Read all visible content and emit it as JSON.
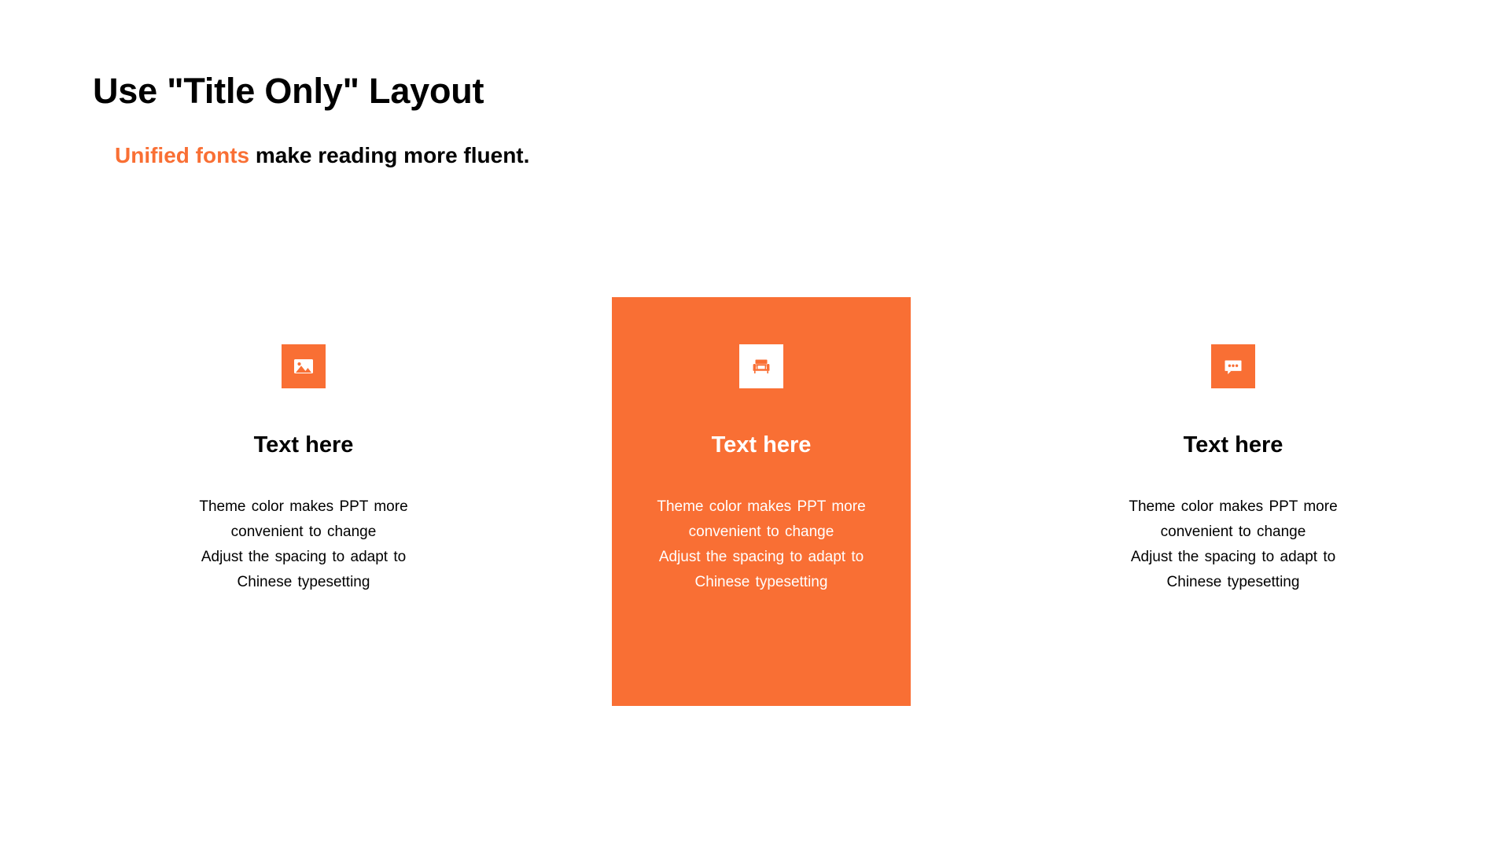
{
  "slide": {
    "background_color": "#FFFFFF",
    "accent_color": "#F96F34",
    "title": "Use \"Title Only\" Layout",
    "subtitle": {
      "accent_text": "Unified fonts",
      "rest_text": " make reading more fluent."
    }
  },
  "columns": [
    {
      "id": "left",
      "icon": "picture-icon",
      "icon_tile_style": "orange-tile-white-glyph",
      "heading": "Text here",
      "body_lines": [
        "Theme  color makes PPT more",
        "convenient to change",
        "Adjust the spacing to adapt to",
        "Chinese typesetting"
      ],
      "text_color": "#000000",
      "panel_color": "#FFFFFF",
      "highlighted": false
    },
    {
      "id": "center",
      "icon": "armchair-icon",
      "icon_tile_style": "white-tile-orange-glyph",
      "heading": "Text here",
      "body_lines": [
        "Theme  color makes PPT more",
        "convenient to change",
        "Adjust the spacing to adapt to",
        "Chinese typesetting"
      ],
      "text_color": "#FFFFFF",
      "panel_color": "#F96F34",
      "highlighted": true
    },
    {
      "id": "right",
      "icon": "chat-bubble-icon",
      "icon_tile_style": "orange-tile-white-glyph",
      "heading": "Text here",
      "body_lines": [
        "Theme  color makes PPT more",
        "convenient to change",
        "Adjust the spacing to adapt to",
        "Chinese typesetting"
      ],
      "text_color": "#000000",
      "panel_color": "#FFFFFF",
      "highlighted": false
    }
  ]
}
